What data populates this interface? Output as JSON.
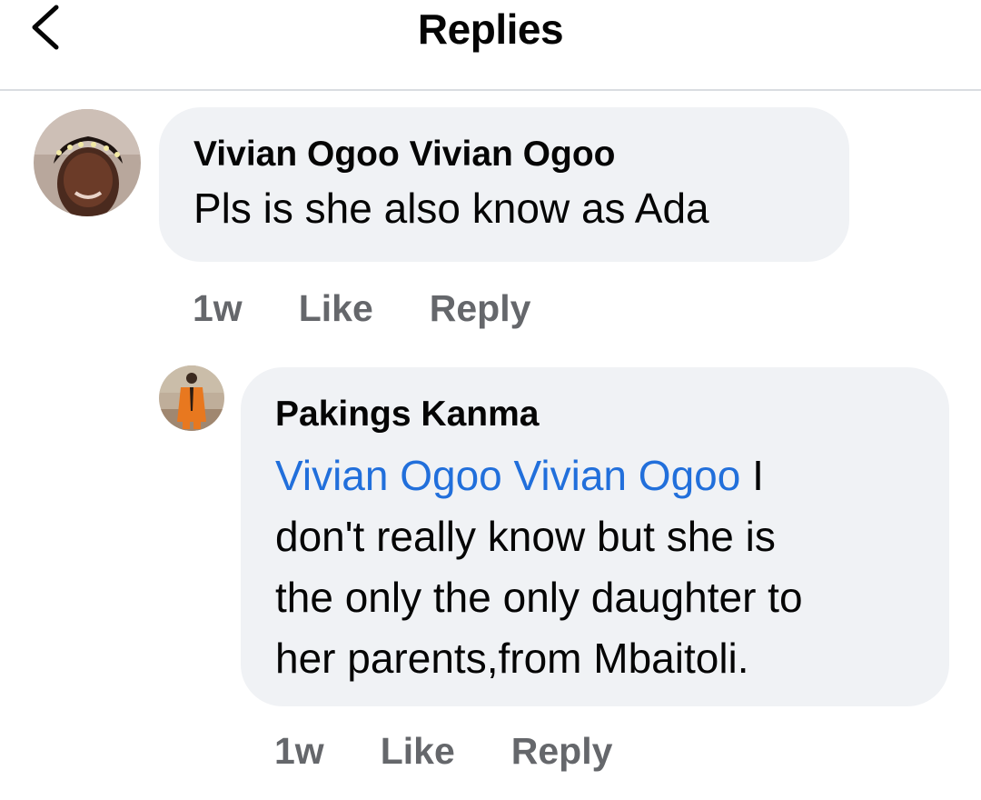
{
  "header": {
    "title": "Replies",
    "back_icon": "chevron-left-icon"
  },
  "comments": [
    {
      "author": "Vivian Ogoo Vivian Ogoo",
      "text": "Pls is she also know as Ada",
      "time": "1w",
      "like_label": "Like",
      "reply_label": "Reply"
    },
    {
      "author": "Pakings Kanma",
      "mention": "Vivian Ogoo Vivian Ogoo",
      "text_line1": " I",
      "text_line2": "don't really know but she is",
      "text_line3": "the only the only daughter to",
      "text_line4": "her parents,from Mbaitoli.",
      "time": "1w",
      "like_label": "Like",
      "reply_label": "Reply"
    }
  ],
  "colors": {
    "bubble_bg": "#f0f2f5",
    "mention": "#216fdb",
    "meta": "#65676b",
    "text": "#050505"
  }
}
